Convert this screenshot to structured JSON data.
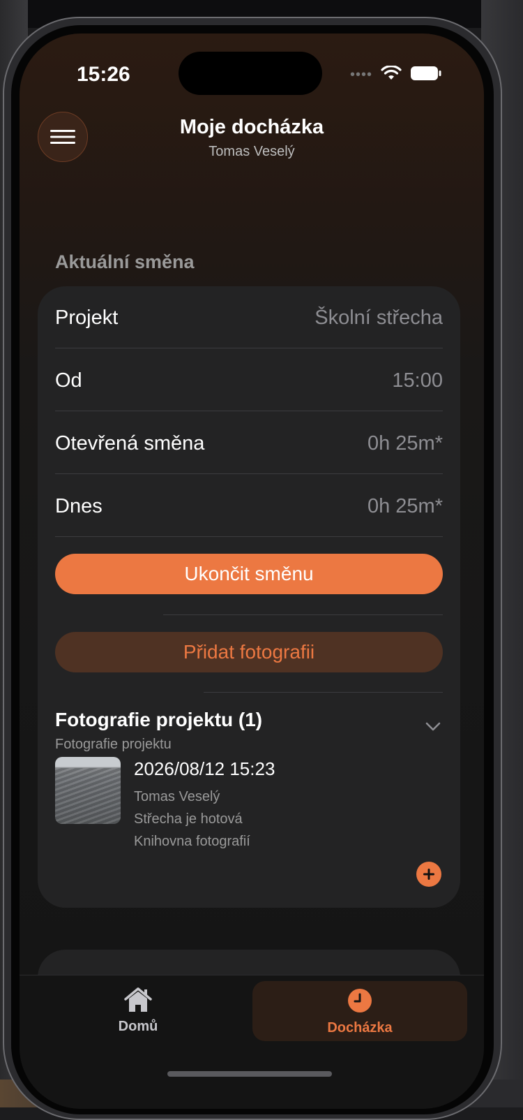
{
  "status_bar": {
    "time": "15:26",
    "signal_dots": "••••"
  },
  "header": {
    "title": "Moje docházka",
    "subtitle": "Tomas Veselý"
  },
  "section": {
    "title": "Aktuální směna"
  },
  "shift_rows": [
    {
      "label": "Projekt",
      "value": "Školní střecha"
    },
    {
      "label": "Od",
      "value": "15:00"
    },
    {
      "label": "Otevřená směna",
      "value": "0h 25m*"
    },
    {
      "label": "Dnes",
      "value": "0h 25m*"
    }
  ],
  "buttons": {
    "end_shift": "Ukončit směnu",
    "add_photo": "Přidat fotografii"
  },
  "photos": {
    "title": "Fotografie projektu (1)",
    "subtitle": "Fotografie projektu",
    "items": [
      {
        "datetime": "2026/08/12 15:23",
        "author": "Tomas Veselý",
        "note": "Střecha je hotová",
        "source": "Knihovna fotografií"
      }
    ]
  },
  "tabbar": {
    "items": [
      {
        "label": "Domů",
        "active": false
      },
      {
        "label": "Docházka",
        "active": true
      }
    ]
  },
  "colors": {
    "accent": "#ec7842",
    "card": "#232324",
    "inactive": "#c7c7cc"
  },
  "icons": [
    "menu-icon",
    "wifi-icon",
    "battery-icon",
    "chevron-down-icon",
    "plus-icon",
    "home-icon",
    "clock-icon"
  ]
}
